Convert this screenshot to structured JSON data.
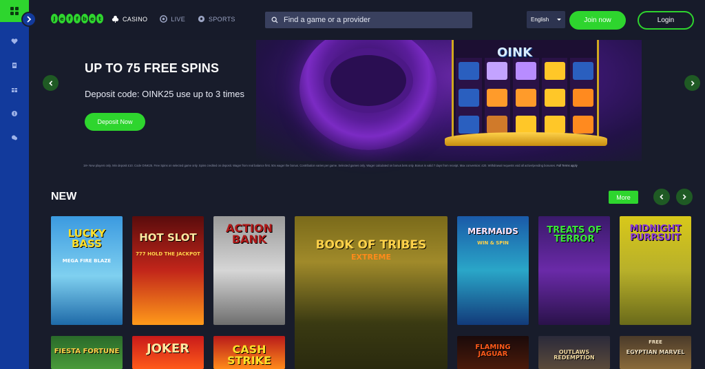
{
  "header": {
    "logo_letters": [
      "J",
      "e",
      "f",
      "f",
      "b",
      "e",
      "t"
    ],
    "nav": [
      {
        "label": "CASINO",
        "icon": "club-icon",
        "active": true
      },
      {
        "label": "LIVE",
        "icon": "live-chip-icon",
        "active": false
      },
      {
        "label": "SPORTS",
        "icon": "football-icon",
        "active": false
      }
    ],
    "search_placeholder": "Find a game or a provider",
    "language": "English",
    "join_label": "Join now",
    "login_label": "Login"
  },
  "sidebar": {
    "icons": [
      "heart-icon",
      "receipt-icon",
      "gift-icon",
      "dollar-coin-icon",
      "chat-icon"
    ]
  },
  "banner": {
    "title": "UP TO 75 FREE SPINS",
    "subtitle": "Deposit code: OINK25 use up to 3 times",
    "cta": "Deposit Now",
    "game_logo": "OINK",
    "terms_text": "18+ New players only. Min deposit £10. Code OINK25. Free Spins on selected game only. Spins credited on deposit. Wager from real balance first. 50x wager the bonus. Contribution varies per game. Selected games only. Wager calculated on bonus bets only. Bonus is valid 7 days from receipt. Max conversion: £20. Withdrawal requests void all active/pending bonuses.",
    "terms_link": "Full Terms apply"
  },
  "new_section": {
    "title": "NEW",
    "more_label": "More",
    "games": [
      {
        "title": "LUCKY BASS",
        "sub": "MEGA FIRE BLAZE"
      },
      {
        "title": "HOT SLOT",
        "sub": "777 HOLD THE JACKPOT"
      },
      {
        "title": "ACTION BANK",
        "sub": ""
      },
      {
        "title": "BOOK OF TRIBES",
        "sub": "EXTREME"
      },
      {
        "title": "MERMAIDS",
        "sub": "WIN & SPIN"
      },
      {
        "title": "TREATS OF TERROR",
        "sub": ""
      },
      {
        "title": "MIDNIGHT PURRSUIT",
        "sub": ""
      },
      {
        "title": "FIESTA FORTUNE",
        "sub": ""
      },
      {
        "title": "JOKER",
        "sub": ""
      },
      {
        "title": "CASH STRIKE",
        "sub": ""
      },
      {
        "title": "FLAMING JAGUAR",
        "sub": ""
      },
      {
        "title": "OUTLAWS REDEMPTION",
        "sub": ""
      },
      {
        "title": "EGYPTIAN MARVEL",
        "sub": "FREE"
      }
    ]
  },
  "colors": {
    "accent_green": "#2ed52e",
    "rail_blue": "#123a9c",
    "background": "#181c2b"
  }
}
